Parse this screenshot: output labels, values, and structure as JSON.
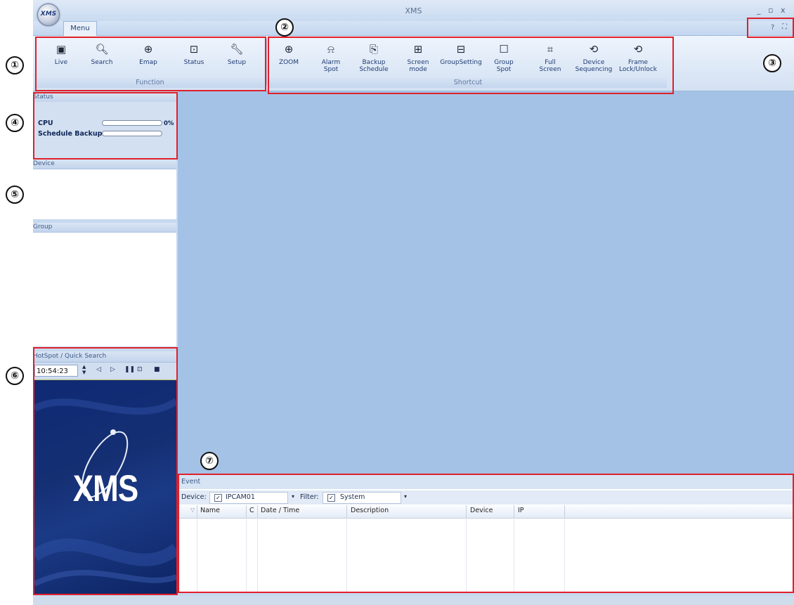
{
  "window": {
    "title": "XMS",
    "logo_text": "XMS",
    "controls": [
      "_",
      "▫",
      "x"
    ]
  },
  "menu_tab": "Menu",
  "help_icons": [
    "?",
    "⛶"
  ],
  "function_group": {
    "label": "Function",
    "buttons": [
      {
        "label": "Live",
        "icon": "monitor-icon"
      },
      {
        "label": "Search",
        "icon": "search-icon"
      },
      {
        "label": "Emap",
        "icon": "globe-icon"
      },
      {
        "label": "Status",
        "icon": "status-monitor-icon"
      },
      {
        "label": "Setup",
        "icon": "wrench-icon"
      }
    ]
  },
  "shortcut_group": {
    "label": "Shortcut",
    "buttons": [
      {
        "label": "ZOOM",
        "icon": "zoom-icon"
      },
      {
        "label": "Alarm\nSpot",
        "icon": "alarm-icon"
      },
      {
        "label": "Backup\nSchedule",
        "icon": "backup-icon"
      },
      {
        "label": "Screen\nmode",
        "icon": "grid-icon"
      },
      {
        "label": "GroupSetting",
        "icon": "network-icon"
      },
      {
        "label": "Group\nSpot",
        "icon": "window-icon"
      },
      {
        "label": "Full\nScreen",
        "icon": "fullscreen-icon"
      },
      {
        "label": "Device\nSequencing",
        "icon": "sequence-icon"
      },
      {
        "label": "Frame\nLock/Unlock",
        "icon": "sequence-icon"
      }
    ]
  },
  "status_panel": {
    "title": "Status",
    "cpu_label": "CPU",
    "cpu_value": "0%",
    "cpu_progress": 0,
    "backup_label": "Schedule Backup",
    "backup_progress": 0
  },
  "device_panel": {
    "title": "Device"
  },
  "group_panel": {
    "title": "Group"
  },
  "hotspot_panel": {
    "title": "HotSpot / Quick Search",
    "time": "10:54:23 AM",
    "preview_logo": "XMS"
  },
  "event_panel": {
    "title": "Event",
    "device_label": "Device:",
    "device_value": "IPCAM01",
    "filter_label": "Filter:",
    "filter_value": "System",
    "columns": [
      "Name",
      "C",
      "Date / Time",
      "Description",
      "Device",
      "IP"
    ]
  },
  "annotations": [
    "①",
    "②",
    "③",
    "④",
    "⑤",
    "⑥",
    "⑦"
  ],
  "colors": {
    "annotation": "#e0202a",
    "main_view": "#a4c2e6",
    "preview_bg": "#152f73"
  }
}
